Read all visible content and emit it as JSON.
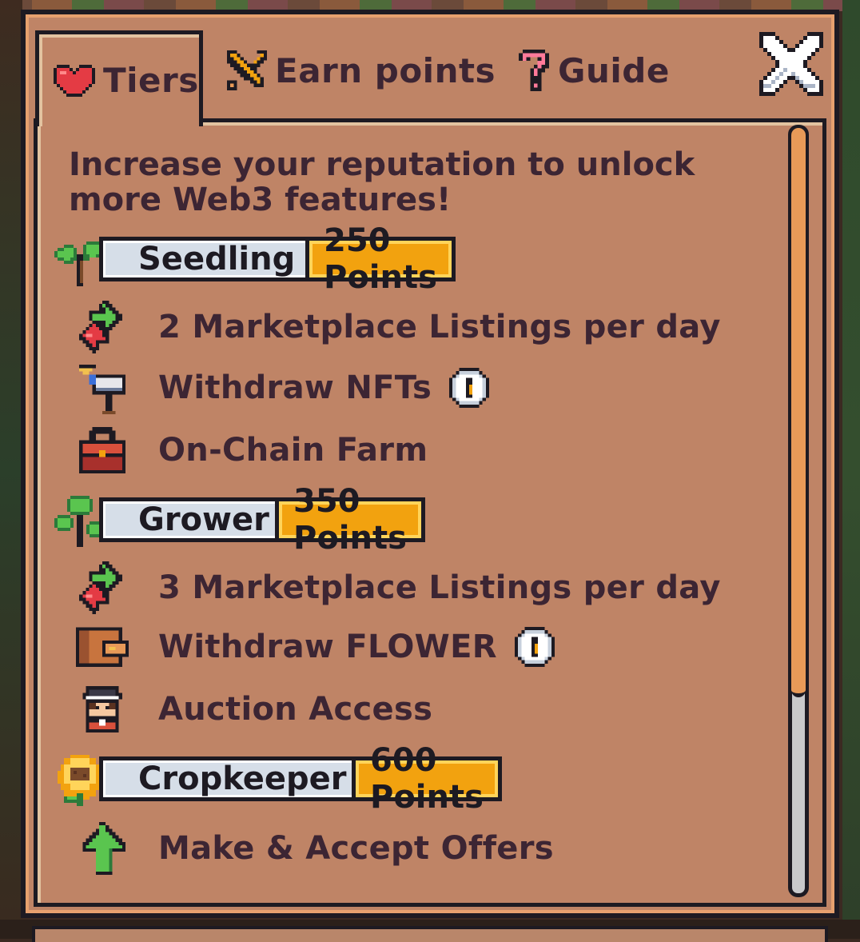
{
  "tabs": [
    {
      "label": "Tiers",
      "icon": "heart-icon",
      "active": true
    },
    {
      "label": "Earn points",
      "icon": "pencil-icon",
      "active": false
    },
    {
      "label": "Guide",
      "icon": "question-icon",
      "active": false
    }
  ],
  "heading": "Increase your reputation to unlock more Web3 features!",
  "tiers": [
    {
      "name": "Seedling",
      "points": "250 Points",
      "icon": "seedling-icon",
      "perks": [
        {
          "label": "2 Marketplace Listings per day",
          "icon": "exchange-arrows-icon",
          "info": false
        },
        {
          "label": "Withdraw NFTs",
          "icon": "mailbox-icon",
          "info": true
        },
        {
          "label": "On-Chain Farm",
          "icon": "toolbox-icon",
          "info": false
        }
      ]
    },
    {
      "name": "Grower",
      "points": "350 Points",
      "icon": "plant-icon",
      "perks": [
        {
          "label": "3 Marketplace Listings per day",
          "icon": "exchange-arrows-icon",
          "info": false
        },
        {
          "label": "Withdraw FLOWER",
          "icon": "wallet-icon",
          "info": true
        },
        {
          "label": "Auction Access",
          "icon": "auctioneer-icon",
          "info": false
        }
      ]
    },
    {
      "name": "Cropkeeper",
      "points": "600 Points",
      "icon": "sunflower-icon",
      "perks": [
        {
          "label": "Make & Accept Offers",
          "icon": "up-arrow-icon",
          "info": false
        }
      ]
    }
  ],
  "colors": {
    "panel": "#bf8466",
    "outline": "#1d1a22",
    "text": "#3c2533",
    "badge_gold": "#f2a20f",
    "badge_silver": "#d6dee8",
    "scroll_thumb": "#e89a58"
  }
}
